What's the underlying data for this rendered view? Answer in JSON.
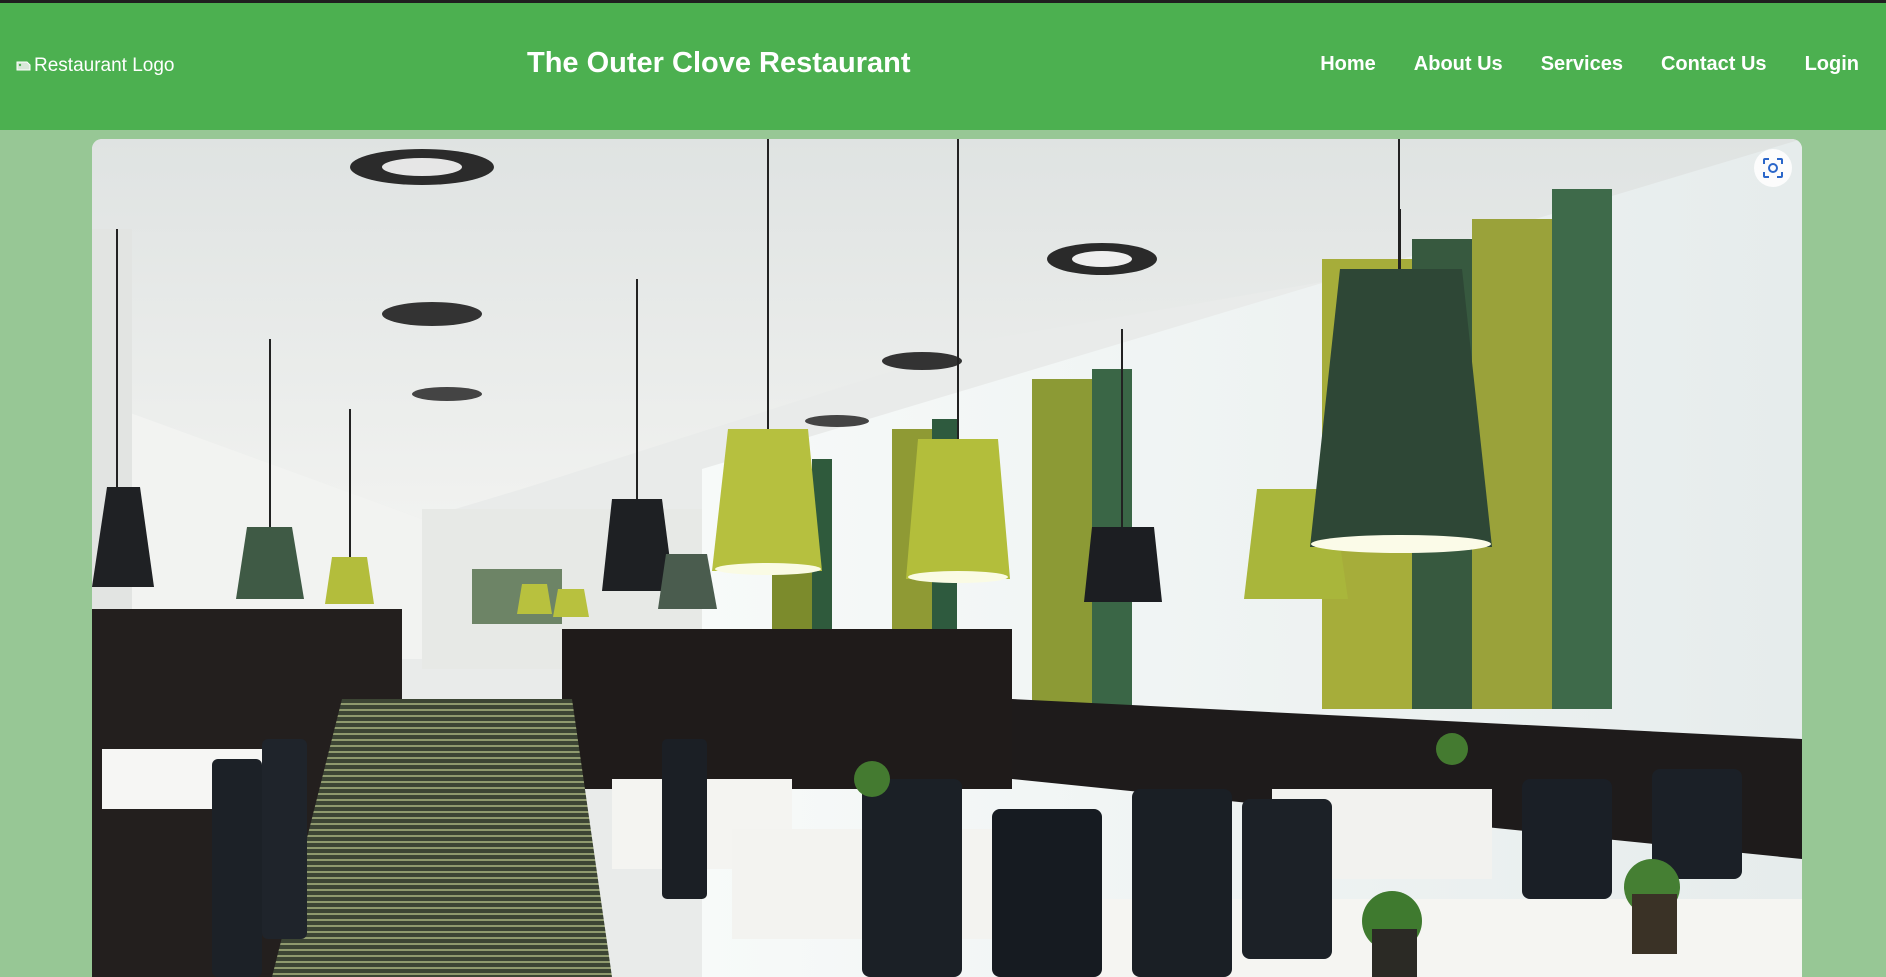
{
  "header": {
    "logo_alt": "Restaurant Logo",
    "title": "The Outer Clove Restaurant",
    "nav": [
      {
        "label": "Home"
      },
      {
        "label": "About Us"
      },
      {
        "label": "Services"
      },
      {
        "label": "Contact Us"
      },
      {
        "label": "Login"
      }
    ]
  },
  "hero": {
    "image_icon": "broken-image-icon",
    "visual_search_icon": "lens-icon"
  },
  "colors": {
    "header_bg": "#4cb050",
    "page_bg": "#97c795",
    "nav_text": "#ffffff"
  }
}
